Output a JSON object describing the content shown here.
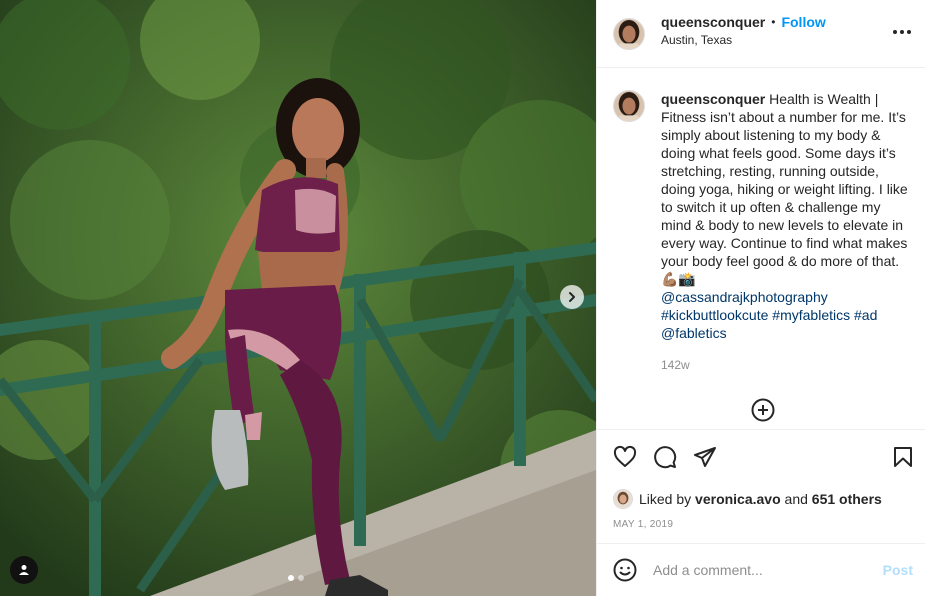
{
  "post": {
    "username": "queensconquer",
    "separator": "•",
    "follow_label": "Follow",
    "location": "Austin, Texas",
    "more_icon": "more-horizontal-icon"
  },
  "caption": {
    "username": "queensconquer",
    "text": "Health is Wealth | Fitness isn’t about a number for me. It’s simply about listening to my body & doing what feels good. Some days it’s stretching, resting, running outside, doing yoga, hiking or weight lifting. I like to switch it up often & challenge my mind & body to new levels to elevate in every way. Continue to find what makes your body feel good & do more of that. 💪🏽📸",
    "mention_1": "@cassandrajkphotography",
    "hashtag_1": "#kickbuttlookcute",
    "hashtag_2": "#myfabletics",
    "hashtag_3": "#ad",
    "mention_2": "@fabletics",
    "time_ago": "142w"
  },
  "likes": {
    "prefix": "Liked by",
    "liker": "veronica.avo",
    "conjunction": "and",
    "others": "651 others"
  },
  "date": "MAY 1, 2019",
  "comment": {
    "placeholder": "Add a comment...",
    "post_label": "Post"
  },
  "carousel": {
    "current": 1,
    "total": 2
  },
  "colors": {
    "accent": "#0095f6",
    "link": "#00376b",
    "muted": "#8e8e8e",
    "post_disabled": "#b2dffc"
  }
}
